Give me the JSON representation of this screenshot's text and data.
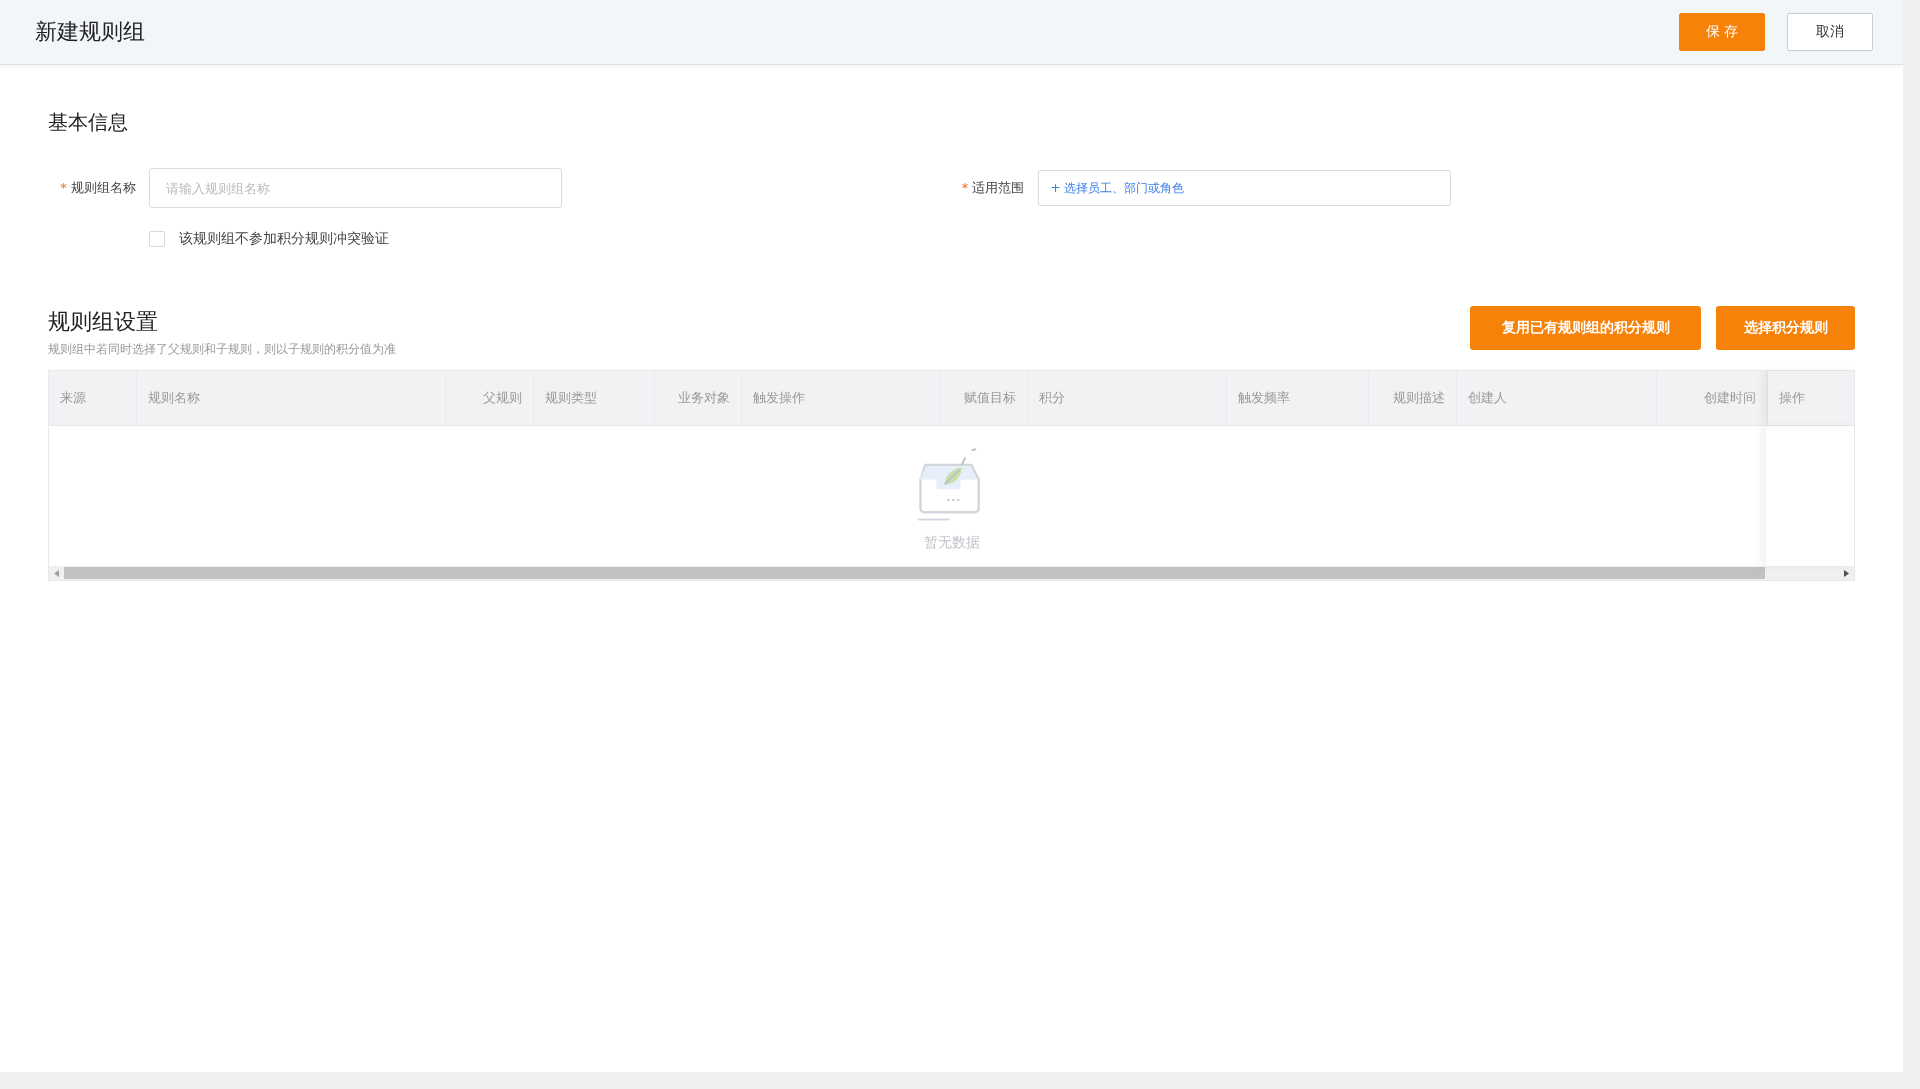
{
  "header": {
    "title": "新建规则组",
    "buttons": [
      {
        "label": "保 存",
        "kind": "primary"
      },
      {
        "label": "取消",
        "kind": "default"
      }
    ]
  },
  "basic_info": {
    "heading": "基本信息",
    "fields": [
      {
        "required_mark": "*",
        "label": "规则组名称",
        "placeholder": "请输入规则组名称",
        "kind": "input"
      },
      {
        "required_mark": "*",
        "label": "适用范围",
        "value": "+ 选择员工、部门或角色",
        "kind": "picker"
      }
    ],
    "checkbox": {
      "label": "该规则组不参加积分规则冲突验证",
      "checked": false
    }
  },
  "rule_settings": {
    "heading": "规则组设置",
    "note": "规则组中若同时选择了父规则和子规则，则以子规则的积分值为准",
    "buttons": [
      "复用已有规则组的积分规则",
      "选择积分规则"
    ],
    "table": {
      "columns": [
        {
          "label": "来源"
        },
        {
          "label": "规则名称"
        },
        {
          "label": "父规则"
        },
        {
          "label": "规则类型"
        },
        {
          "label": "业务对象"
        },
        {
          "label": "触发操作"
        },
        {
          "label": "赋值目标"
        },
        {
          "label": "积分"
        },
        {
          "label": "触发频率"
        },
        {
          "label": "规则描述"
        },
        {
          "label": "创建人"
        },
        {
          "label": "创建时间"
        },
        {
          "label": "操作"
        }
      ],
      "empty_text": "暂无数据"
    }
  }
}
